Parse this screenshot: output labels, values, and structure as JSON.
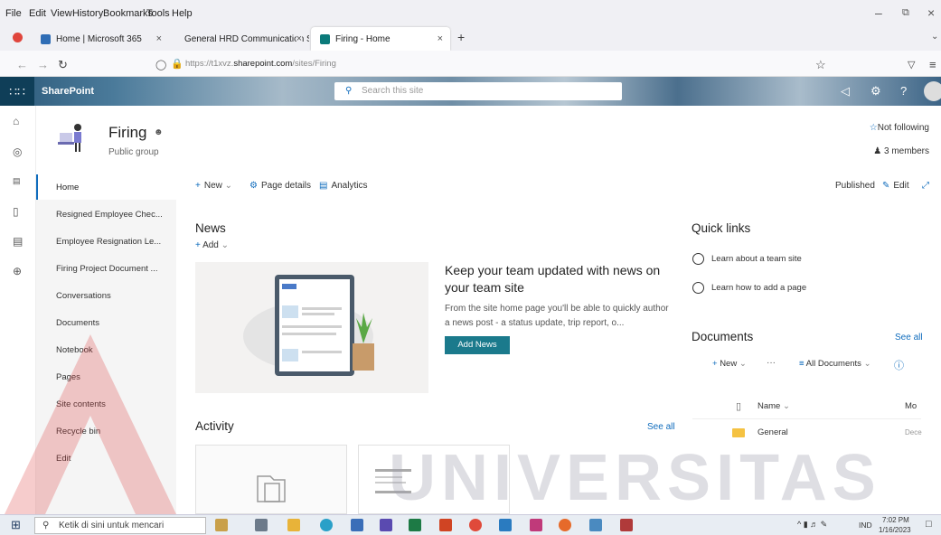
{
  "menubar": {
    "items": [
      "File",
      "Edit",
      "View",
      "History",
      "Bookmarks",
      "Tools",
      "Help"
    ]
  },
  "tabs": [
    {
      "label": "Home | Microsoft 365",
      "close": "×"
    },
    {
      "label": "General HRD Communication S",
      "close": "×"
    },
    {
      "label": "Firing - Home",
      "close": "×"
    }
  ],
  "new_tab": "+",
  "url": {
    "prefix": "https://t1xvz.",
    "domain": "sharepoint.com",
    "path": "/sites/Firing"
  },
  "header": {
    "app": "SharePoint",
    "search_placeholder": "Search this site"
  },
  "site": {
    "name": "Firing",
    "type": "Public group",
    "follow": "Not following",
    "members": "3 members"
  },
  "leftnav": [
    "Home",
    "Resigned Employee Chec...",
    "Employee Resignation Le...",
    "Firing Project Document ...",
    "Conversations",
    "Documents",
    "Notebook",
    "Pages",
    "Site contents",
    "Recycle bin",
    "Edit"
  ],
  "commandbar": {
    "new": "New",
    "page_details": "Page details",
    "analytics": "Analytics",
    "published": "Published",
    "edit": "Edit"
  },
  "news": {
    "title": "News",
    "add": "Add",
    "heading": "Keep your team updated with news on your team site",
    "body": "From the site home page you'll be able to quickly author a news post - a status update, trip report, o...",
    "button": "Add News"
  },
  "activity": {
    "title": "Activity",
    "see_all": "See all"
  },
  "quicklinks": {
    "title": "Quick links",
    "items": [
      "Learn about a team site",
      "Learn how to add a page"
    ]
  },
  "documents": {
    "title": "Documents",
    "see_all": "See all",
    "new": "New",
    "more": "···",
    "view": "All Documents",
    "col_name": "Name",
    "col_modified": "Mo",
    "rows": [
      {
        "name": "General",
        "modified": "Dece"
      }
    ]
  },
  "taskbar": {
    "search": "Ketik di sini untuk mencari",
    "lang": "IND",
    "time": "7:02 PM",
    "date": "1/16/2023"
  },
  "watermark": "UNIVERSITAS",
  "colors": {
    "accent": "#0f6cbd",
    "teal": "#1b7a8c",
    "suite": "#0f3e58"
  }
}
